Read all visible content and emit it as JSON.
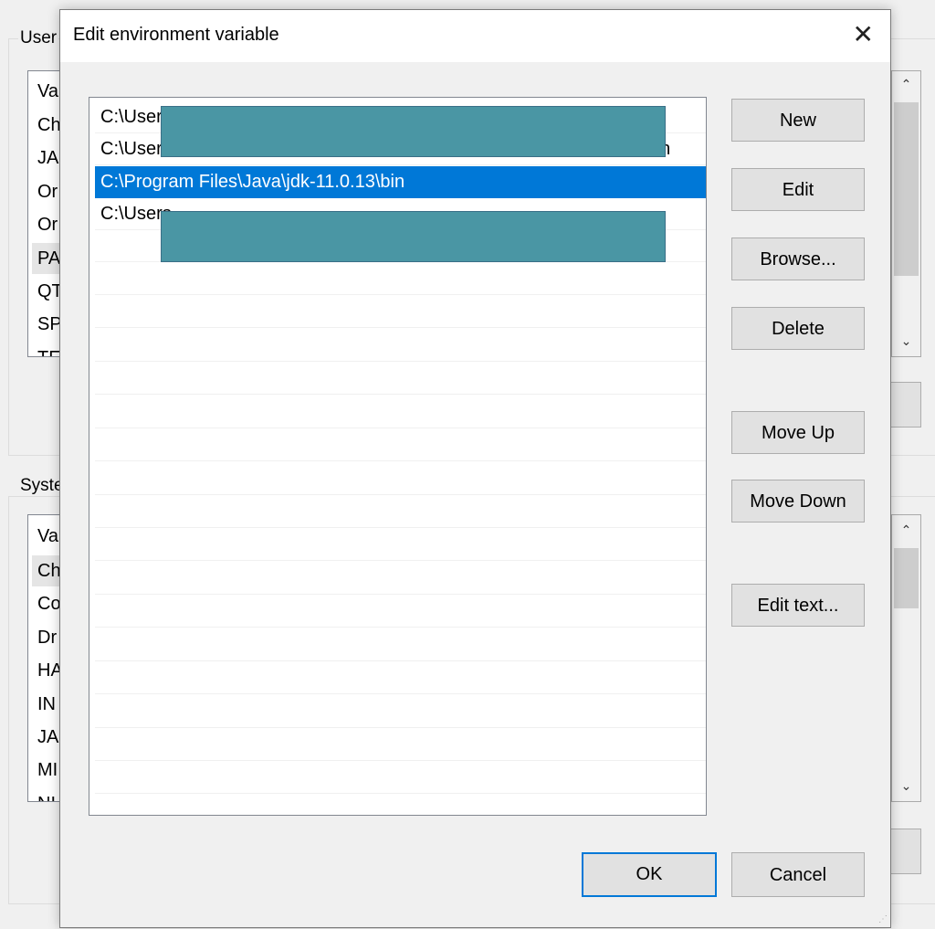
{
  "background": {
    "user_group_label": "User",
    "user_list": [
      "Va",
      "Ch",
      "JA",
      "Or",
      "Or",
      "PA",
      "QT",
      "SP",
      "TE"
    ],
    "user_selected_index": 5,
    "system_group_label": "Syste",
    "system_list": [
      "Va",
      "Ch",
      "Co",
      "Dr",
      "HA",
      "IN",
      "JA",
      "MI",
      "NI"
    ],
    "system_selected_index": 1
  },
  "dialog": {
    "title": "Edit environment variable",
    "close_icon": "close-icon",
    "entries": [
      {
        "text": "C:\\Users",
        "tail": "",
        "redacted": true
      },
      {
        "text": "C:\\Users",
        "tail": "\\bin",
        "redacted": false
      },
      {
        "text": "C:\\Program Files\\Java\\jdk-11.0.13\\bin",
        "tail": "",
        "selected": true
      },
      {
        "text": "C:\\Users",
        "tail": "",
        "redacted": true
      }
    ],
    "buttons": {
      "new": "New",
      "edit": "Edit",
      "browse": "Browse...",
      "delete": "Delete",
      "move_up": "Move Up",
      "move_down": "Move Down",
      "edit_text": "Edit text...",
      "ok": "OK",
      "cancel": "Cancel"
    },
    "colors": {
      "selection": "#0078d7",
      "redaction": "#4a96a4"
    }
  }
}
